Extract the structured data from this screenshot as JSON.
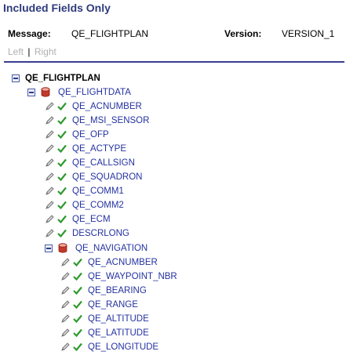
{
  "page": {
    "title": "Included Fields Only"
  },
  "meta": {
    "message_label": "Message:",
    "message_value": "QE_FLIGHTPLAN",
    "version_label": "Version:",
    "version_value": "VERSION_1"
  },
  "nav": {
    "left": "Left",
    "right": "Right",
    "separator": "|"
  },
  "tree": {
    "root": {
      "label": "QE_FLIGHTPLAN",
      "icon": "collapse-icon"
    },
    "flightdata": {
      "label": "QE_FLIGHTDATA",
      "icons": [
        "collapse-icon",
        "record-icon"
      ],
      "fields": [
        "QE_ACNUMBER",
        "QE_MSI_SENSOR",
        "QE_OFP",
        "QE_ACTYPE",
        "QE_CALLSIGN",
        "QE_SQUADRON",
        "QE_COMM1",
        "QE_COMM2",
        "QE_ECM",
        "DESCRLONG"
      ]
    },
    "navigation": {
      "label": "QE_NAVIGATION",
      "icons": [
        "collapse-icon",
        "record-icon"
      ],
      "fields": [
        "QE_ACNUMBER",
        "QE_WAYPOINT_NBR",
        "QE_BEARING",
        "QE_RANGE",
        "QE_ALTITUDE",
        "QE_LATITUDE",
        "QE_LONGITUDE"
      ]
    },
    "field_icons": [
      "pencil-icon",
      "check-icon"
    ]
  },
  "colors": {
    "title": "#2f3b7c",
    "link": "#2432a0",
    "rule": "#3a3f8f",
    "check": "#2e9a2e",
    "record": "#c0392b"
  }
}
